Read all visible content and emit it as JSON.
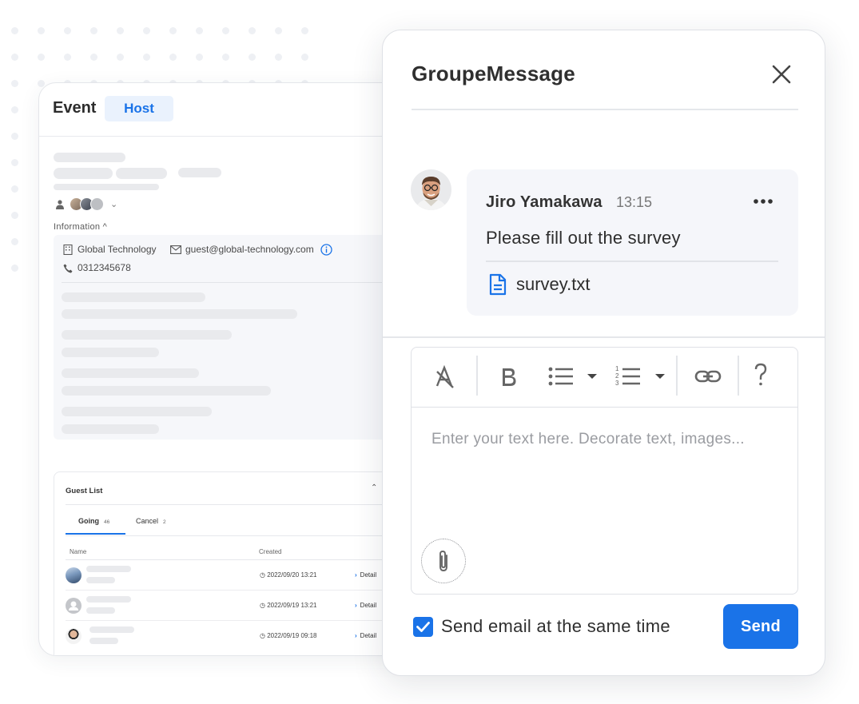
{
  "event_panel": {
    "title": "Event",
    "tab": "Host",
    "information_label": "Information ^",
    "company": "Global Technology",
    "email": "guest@global-technology.com",
    "phone": "0312345678",
    "guest_list": {
      "title": "Guest List",
      "tabs": [
        {
          "label": "Going",
          "count": "46"
        },
        {
          "label": "Cancel",
          "count": "2"
        }
      ],
      "columns": [
        "Name",
        "Created"
      ],
      "rows": [
        {
          "created": "2022/09/20 13:21",
          "action": "Detail"
        },
        {
          "created": "2022/09/19 13:21",
          "action": "Detail"
        },
        {
          "created": "2022/09/19 09:18",
          "action": "Detail"
        }
      ]
    }
  },
  "message_dialog": {
    "title": "GroupeMessage",
    "message": {
      "sender": "Jiro Yamakawa",
      "time": "13:15",
      "text": "Please fill out the survey",
      "attachment": "survey.txt"
    },
    "toolbar_icons": [
      "clear-format-icon",
      "bold-icon",
      "bullet-list-icon",
      "numbered-list-icon",
      "link-icon",
      "help-icon"
    ],
    "editor_placeholder": "Enter your text here. Decorate text, images...",
    "send_email_label": "Send email at the same time",
    "send_email_checked": true,
    "send_button": "Send",
    "accent_color": "#1a73e8"
  }
}
